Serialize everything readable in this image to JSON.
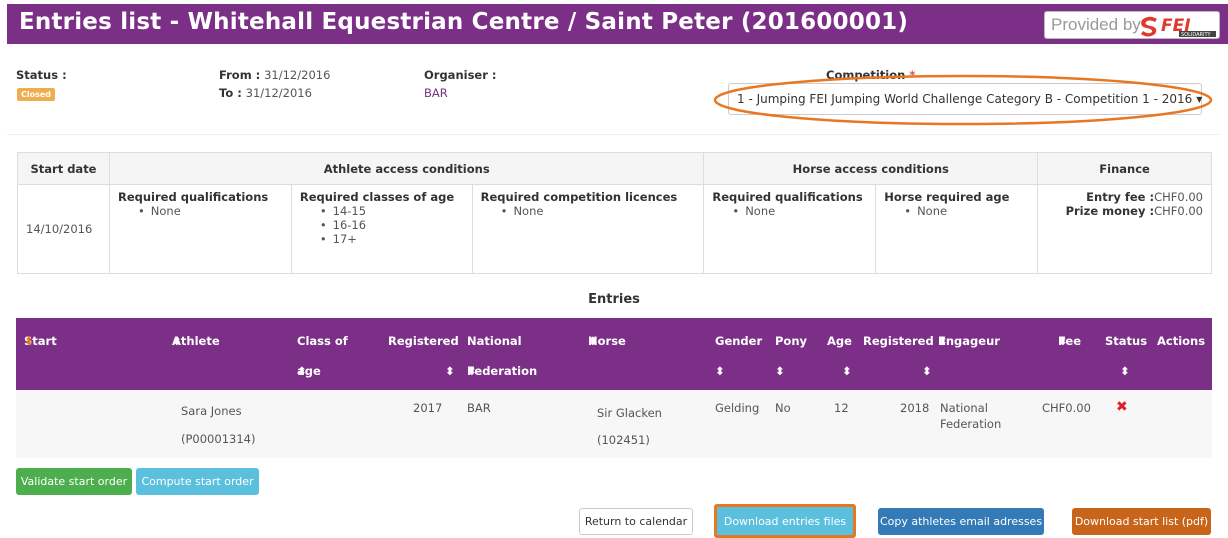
{
  "header": {
    "title": "Entries list - Whitehall Equestrian Centre / Saint Peter (201600001)",
    "provided_by": "Provided by",
    "logo_text": "FEI",
    "logo_sub": "SOLIDARITY"
  },
  "info": {
    "status_label": "Status :",
    "status_value": "Closed",
    "from_label": "From :",
    "from_value": "31/12/2016",
    "to_label": "To :",
    "to_value": "31/12/2016",
    "organiser_label": "Organiser :",
    "organiser_value": "BAR",
    "competition_label": "Competition",
    "competition_required": "*",
    "competition_value": "1 - Jumping FEI Jumping World Challenge Category B - Competition 1 - 2016"
  },
  "conditions": {
    "headers": {
      "start_date": "Start date",
      "athlete": "Athlete access conditions",
      "horse": "Horse access conditions",
      "finance": "Finance"
    },
    "start_date": "14/10/2016",
    "req_qual_label": "Required qualifications",
    "req_qual": [
      "None"
    ],
    "req_age_label": "Required classes of age",
    "req_age": [
      "14-15",
      "16-16",
      "17+"
    ],
    "req_lic_label": "Required competition licences",
    "req_lic": [
      "None"
    ],
    "horse_qual_label": "Required qualifications",
    "horse_qual": [
      "None"
    ],
    "horse_age_label": "Horse required age",
    "horse_age": [
      "None"
    ],
    "entry_fee_label": "Entry fee :",
    "entry_fee": "CHF0.00",
    "prize_label": "Prize money :",
    "prize": "CHF0.00"
  },
  "entries": {
    "title": "Entries",
    "columns": {
      "start": "Start",
      "athlete": "Athlete",
      "class1": "Class of",
      "class2": "age",
      "registered": "Registered",
      "nat1": "National",
      "nat2": "Federation",
      "horse": "Horse",
      "gender": "Gender",
      "pony": "Pony",
      "age": "Age",
      "registered2": "Registered",
      "engageur": "Engageur",
      "fee": "Fee",
      "status": "Status",
      "actions": "Actions",
      "sort": "⬍"
    },
    "row": {
      "athlete": "Sara Jones",
      "athlete_id": "(P00001314)",
      "registered": "2017",
      "nf": "BAR",
      "horse": "Sir Glacken",
      "horse_id": "(102451)",
      "gender": "Gelding",
      "pony": "No",
      "age": "12",
      "registered2": "2018",
      "engageur1": "National",
      "engageur2": "Federation",
      "fee": "CHF0.00",
      "status": "✖"
    }
  },
  "buttons": {
    "validate": "Validate start order",
    "compute": "Compute start order",
    "return": "Return to calendar",
    "download_entries": "Download entries files",
    "copy_emails": "Copy athletes email adresses",
    "download_start": "Download start list (pdf)"
  },
  "colors": {
    "brand": "#7b2f86",
    "highlight": "#e87722"
  }
}
